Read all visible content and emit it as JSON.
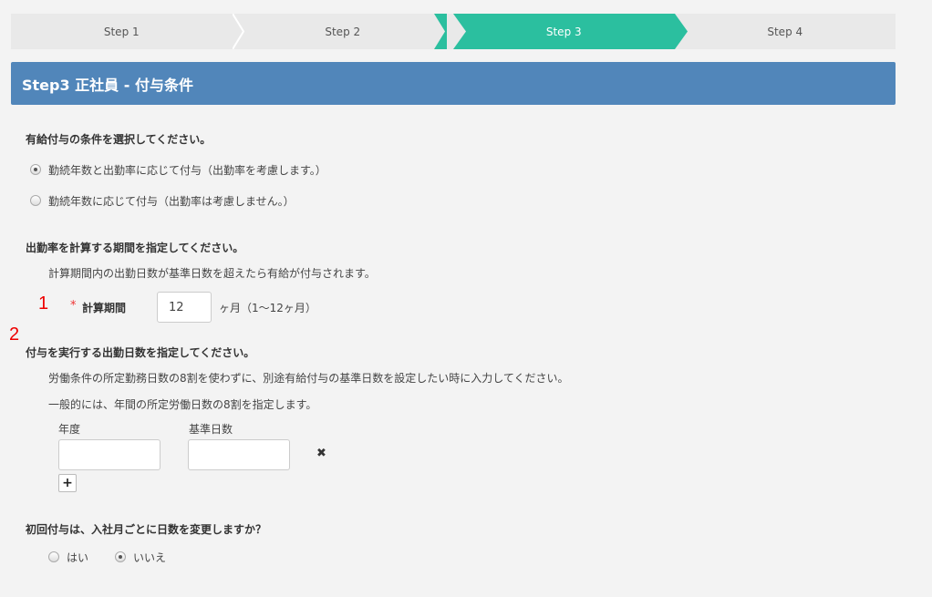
{
  "steps": [
    {
      "label": "Step 1",
      "active": false
    },
    {
      "label": "Step 2",
      "active": false
    },
    {
      "label": "Step 3",
      "active": true
    },
    {
      "label": "Step 4",
      "active": false
    }
  ],
  "header": {
    "title": "Step3 正社員 - 付与条件"
  },
  "condition": {
    "question": "有給付与の条件を選択してください。",
    "options": [
      {
        "label": "勤続年数と出勤率に応じて付与（出勤率を考慮します。）",
        "checked": true
      },
      {
        "label": "勤続年数に応じて付与（出勤率は考慮しません。）",
        "checked": false
      }
    ]
  },
  "period": {
    "question": "出勤率を計算する期間を指定してください。",
    "description": "計算期間内の出勤日数が基準日数を超えたら有給が付与されます。",
    "marker": "1",
    "required_mark": "*",
    "field_label": "計算期間",
    "value": "12",
    "unit_text": "ヶ月（1〜12ヶ月）"
  },
  "days": {
    "marker": "2",
    "question": "付与を実行する出勤日数を指定してください。",
    "description1": "労働条件の所定勤務日数の8割を使わずに、別途有給付与の基準日数を設定したい時に入力してください。",
    "description2": "一般的には、年間の所定労働日数の8割を指定します。",
    "col_year": "年度",
    "col_days": "基準日数",
    "year_value": "",
    "days_value": "",
    "remove_icon": "✖",
    "add_icon": "+"
  },
  "first_grant": {
    "question": "初回付与は、入社月ごとに日数を変更しますか？",
    "options": [
      {
        "label": "はい",
        "checked": false
      },
      {
        "label": "いいえ",
        "checked": true
      }
    ]
  }
}
